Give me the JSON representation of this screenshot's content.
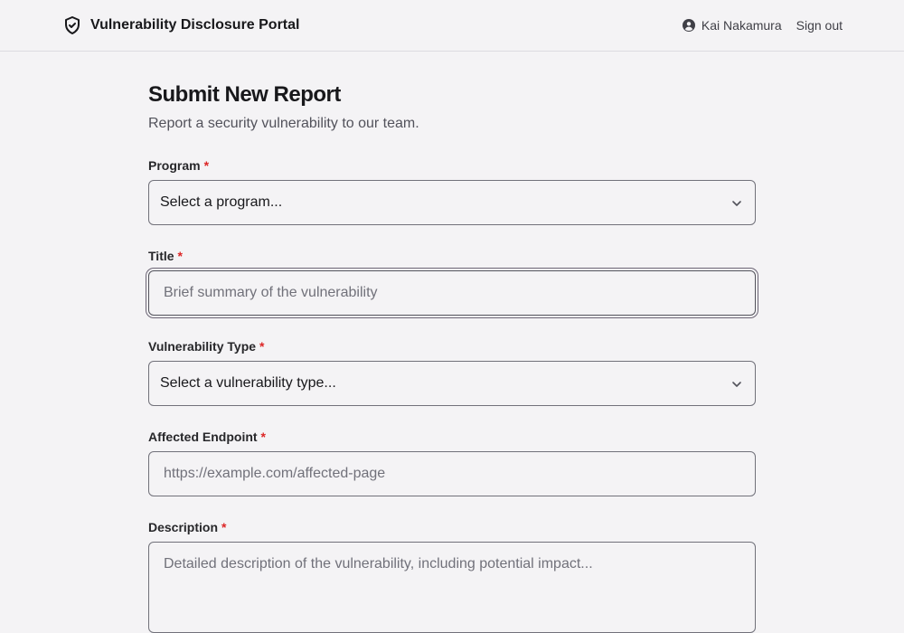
{
  "header": {
    "title": "Vulnerability Disclosure Portal",
    "user_name": "Kai Nakamura",
    "sign_out": "Sign out"
  },
  "form": {
    "title": "Submit New Report",
    "subtitle": "Report a security vulnerability to our team.",
    "required_marker": "*",
    "program": {
      "label": "Program",
      "value": "Select a program..."
    },
    "report_title": {
      "label": "Title",
      "placeholder": "Brief summary of the vulnerability"
    },
    "vuln_type": {
      "label": "Vulnerability Type",
      "value": "Select a vulnerability type..."
    },
    "endpoint": {
      "label": "Affected Endpoint",
      "placeholder": "https://example.com/affected-page"
    },
    "description": {
      "label": "Description",
      "placeholder": "Detailed description of the vulnerability, including potential impact..."
    }
  },
  "icons": {
    "brand": "shield-check-icon",
    "user": "user-circle-icon",
    "select": "chevron-down-icon"
  },
  "colors": {
    "background": "#f4f3f5",
    "required": "#dc2626",
    "border": "#71717a"
  }
}
